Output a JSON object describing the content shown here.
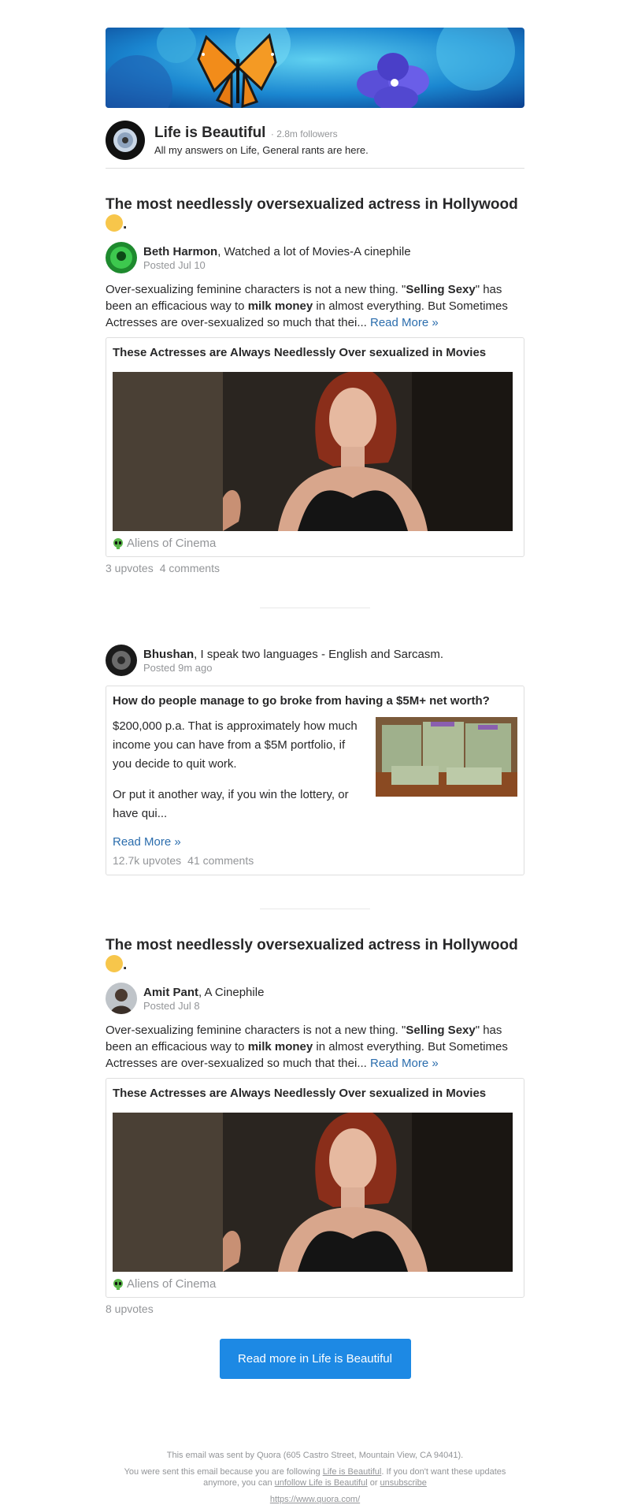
{
  "space": {
    "name": "Life is Beautiful",
    "followers": "· 2.8m followers",
    "description": "All my answers on Life, General rants are here."
  },
  "story1": {
    "title": "The most needlessly oversexualized actress in Hollywood",
    "title_suffix": ".",
    "author_name": "Beth Harmon",
    "author_cred": ", Watched a lot of Movies-A cinephile",
    "posted": "Posted Jul 10",
    "excerpt_a": "Over-sexualizing feminine characters is not a new thing. \"",
    "excerpt_b": "Selling Sexy",
    "excerpt_c": "\" has been an efficacious way to ",
    "excerpt_d": "milk money",
    "excerpt_e": " in almost everything. But Sometimes Actresses are over-sexualized so much that thei... ",
    "read_more": "Read More »",
    "card_title": "These Actresses are Always Needlessly Over sexualized in Movies",
    "card_source": "Aliens of Cinema",
    "upvotes": "3 upvotes",
    "comments": "4 comments"
  },
  "story2": {
    "author_name": "Bhushan",
    "author_cred": ", I speak two languages - English and Sarcasm.",
    "posted": "Posted 9m ago",
    "card_title": "How do people manage to go broke from having a $5M+ net worth?",
    "para1": "$200,000 p.a. That is approximately how much income you can have from a $5M portfolio, if you decide to quit work.",
    "para2": "Or put it another way, if you win the lottery, or have qui...",
    "read_more": "Read More »",
    "upvotes": "12.7k upvotes",
    "comments": "41 comments"
  },
  "story3": {
    "title": "The most needlessly oversexualized actress in Hollywood",
    "title_suffix": ".",
    "author_name": "Amit Pant",
    "author_cred": ", A Cinephile",
    "posted": "Posted Jul 8",
    "excerpt_a": "Over-sexualizing feminine characters is not a new thing. \"",
    "excerpt_b": "Selling Sexy",
    "excerpt_c": "\" has been an efficacious way to ",
    "excerpt_d": "milk money",
    "excerpt_e": " in almost everything. But Sometimes Actresses are over-sexualized so much that thei... ",
    "read_more": "Read More »",
    "card_title": "These Actresses are Always Needlessly Over sexualized in Movies",
    "card_source": "Aliens of Cinema",
    "upvotes": "8 upvotes"
  },
  "cta": {
    "label": "Read more in Life is Beautiful"
  },
  "footer": {
    "line1": "This email was sent by Quora (605 Castro Street, Mountain View, CA 94041).",
    "line2a": "You were sent this email because you are following ",
    "line2_link1": "Life is Beautiful",
    "line2b": ". If you don't want these updates anymore, you can ",
    "line2_link2": "unfollow Life is Beautiful",
    "line2c": " or ",
    "line2_link3": "unsubscribe",
    "url": "https://www.quora.com/"
  },
  "colors": {
    "accent": "#1d89e4",
    "link": "#2b6dad",
    "muted": "#939598",
    "text": "#282829"
  }
}
